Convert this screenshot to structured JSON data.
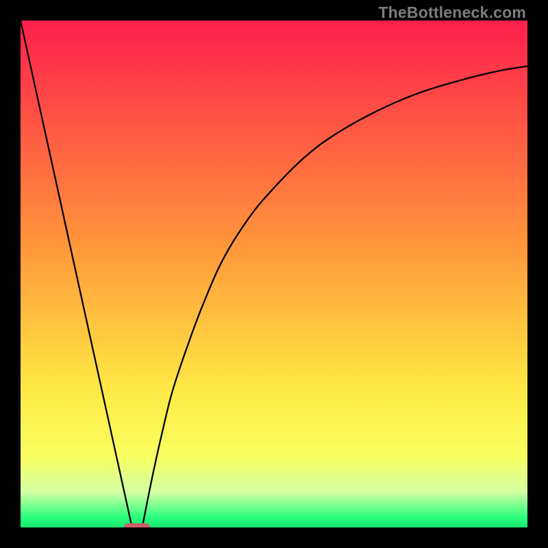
{
  "watermark": "TheBottleneck.com",
  "chart_data": {
    "type": "line",
    "title": "",
    "xlabel": "",
    "ylabel": "",
    "xlim": [
      0,
      100
    ],
    "ylim": [
      0,
      100
    ],
    "gradient_stops": [
      {
        "pos": 0.0,
        "color": "#ff1f4d"
      },
      {
        "pos": 0.45,
        "color": "#ff983a"
      },
      {
        "pos": 0.72,
        "color": "#ffe744"
      },
      {
        "pos": 0.86,
        "color": "#f7ff60"
      },
      {
        "pos": 0.93,
        "color": "#d4ffa3"
      },
      {
        "pos": 0.98,
        "color": "#2bff7e"
      },
      {
        "pos": 1.0,
        "color": "#16e66e"
      }
    ],
    "series": [
      {
        "name": "left-slope",
        "x": [
          0,
          22
        ],
        "values": [
          100,
          0
        ]
      },
      {
        "name": "right-curve",
        "x": [
          24,
          26,
          28,
          30,
          33,
          36,
          40,
          45,
          50,
          56,
          62,
          70,
          78,
          86,
          94,
          100
        ],
        "values": [
          0,
          10,
          19,
          27,
          36,
          44,
          53,
          61,
          67,
          73,
          77.5,
          82,
          85.5,
          88,
          90,
          91
        ]
      }
    ],
    "marker": {
      "x": 23,
      "y": 0,
      "color": "#cd5d66"
    }
  }
}
